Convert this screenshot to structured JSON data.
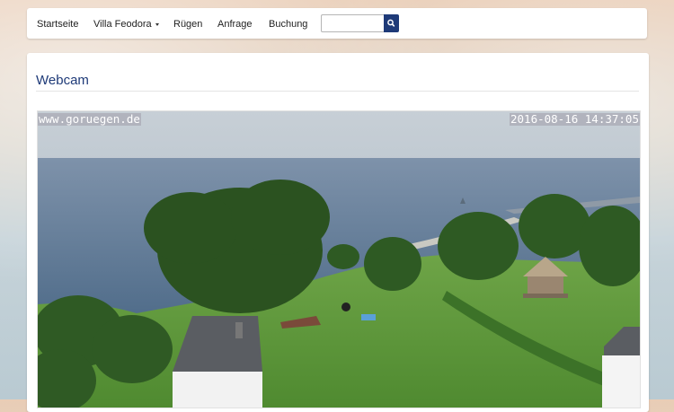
{
  "nav": {
    "items": [
      {
        "label": "Startseite"
      },
      {
        "label": "Villa Feodora"
      },
      {
        "label": "Rügen"
      },
      {
        "label": "Anfrage"
      },
      {
        "label": "Buchung"
      }
    ],
    "search": {
      "placeholder": "",
      "value": "",
      "icon": "search-icon"
    }
  },
  "main": {
    "title": "Webcam",
    "webcam": {
      "watermark": "www.goruegen.de",
      "timestamp": "2016-08-16 14:37:05"
    }
  },
  "colors": {
    "brand": "#1e3a78",
    "sea": "#5a7a9a",
    "lawn": "#5f9a3c",
    "tree": "#2f5a24"
  }
}
